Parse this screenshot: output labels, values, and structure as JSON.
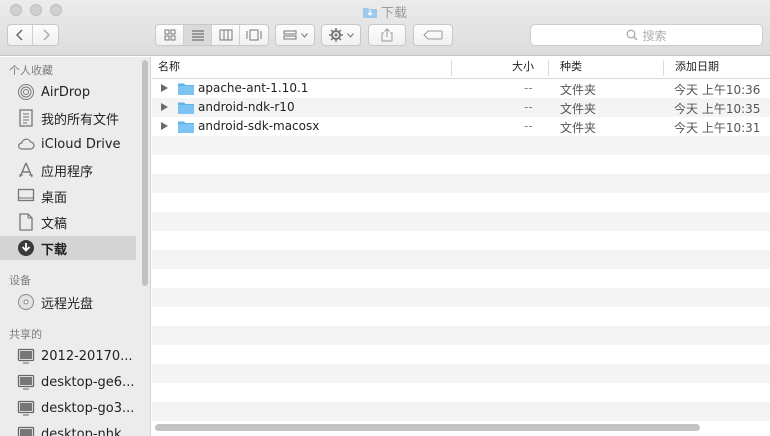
{
  "window": {
    "title": "下载"
  },
  "toolbar": {
    "view_buttons": [
      "icon-view-icon",
      "list-view-icon",
      "column-view-icon",
      "gallery-view-icon"
    ],
    "search_placeholder": "搜索"
  },
  "sidebar": {
    "sections": [
      {
        "label": "个人收藏",
        "items": [
          {
            "label": "AirDrop",
            "icon": "airdrop-icon"
          },
          {
            "label": "我的所有文件",
            "icon": "all-files-icon"
          },
          {
            "label": "iCloud Drive",
            "icon": "cloud-icon"
          },
          {
            "label": "应用程序",
            "icon": "applications-icon"
          },
          {
            "label": "桌面",
            "icon": "desktop-icon"
          },
          {
            "label": "文稿",
            "icon": "documents-icon"
          },
          {
            "label": "下载",
            "icon": "download-icon",
            "selected": true
          }
        ]
      },
      {
        "label": "设备",
        "items": [
          {
            "label": "远程光盘",
            "icon": "disc-icon"
          }
        ]
      },
      {
        "label": "共享的",
        "items": [
          {
            "label": "2012-20170...",
            "icon": "computer-icon"
          },
          {
            "label": "desktop-ge6...",
            "icon": "computer-icon"
          },
          {
            "label": "desktop-go3...",
            "icon": "computer-icon"
          },
          {
            "label": "desktop-nhk...",
            "icon": "computer-icon"
          }
        ]
      }
    ]
  },
  "list": {
    "columns": {
      "name": "名称",
      "size": "大小",
      "kind": "种类",
      "date": "添加日期"
    },
    "rows": [
      {
        "name": "apache-ant-1.10.1",
        "size": "--",
        "kind": "文件夹",
        "date": "今天 上午10:36"
      },
      {
        "name": "android-ndk-r10",
        "size": "--",
        "kind": "文件夹",
        "date": "今天 上午10:35"
      },
      {
        "name": "android-sdk-macosx",
        "size": "--",
        "kind": "文件夹",
        "date": "今天 上午10:31"
      }
    ],
    "empty_rows": 15
  },
  "colors": {
    "folder": "#5fb4ea",
    "selected_sidebar": "#d5d5d5"
  }
}
